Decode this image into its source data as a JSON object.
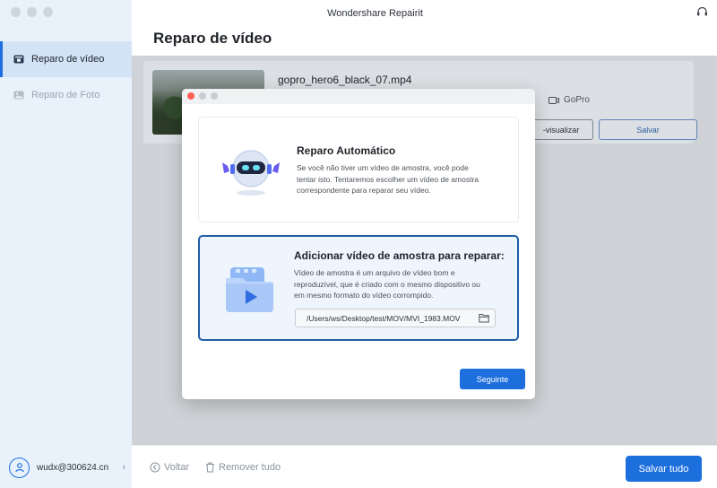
{
  "app": {
    "title": "Wondershare Repairit"
  },
  "sidebar": {
    "items": [
      {
        "label": "Reparo de vídeo",
        "icon": "video-repair-icon",
        "active": true
      },
      {
        "label": "Reparo de Foto",
        "icon": "photo-repair-icon",
        "active": false
      }
    ],
    "user": {
      "email": "wudx@300624.cn",
      "chevron": "›"
    }
  },
  "main": {
    "page_title": "Reparo de vídeo",
    "file": {
      "name": "gopro_hero6_black_07.mp4",
      "camera": "GoPro",
      "preview_label": "-visualizar",
      "save_label": "Salvar"
    },
    "bottom_bar": {
      "back_label": "Voltar",
      "remove_all_label": "Remover tudo",
      "save_all_label": "Salvar tudo"
    }
  },
  "modal": {
    "auto": {
      "title": "Reparo Automático",
      "desc_lines": [
        "Se você não tiver um vídeo de amostra, você pode",
        "tentar isto. Tentaremos escolher um vídeo de amostra",
        "correspondente para reparar seu vídeo."
      ]
    },
    "sample": {
      "title": "Adicionar vídeo de amostra para reparar:",
      "desc_lines": [
        "Vídeo de amostra é um arquivo de vídeo bom e",
        "reproduzível, que é criado com o mesmo dispositivo ou",
        "em mesmo formato do vídeo corrompido."
      ],
      "path": "/Users/ws/Desktop/test/MOV/MVI_1983.MOV"
    },
    "next_label": "Seguinte"
  },
  "colors": {
    "accent": "#1d6fde",
    "sidebar_bg": "#e9f2fb",
    "selected_border": "#1f5fa7",
    "dot_close": "#fe5f57",
    "dot_inactive": "#c9cdd2"
  }
}
